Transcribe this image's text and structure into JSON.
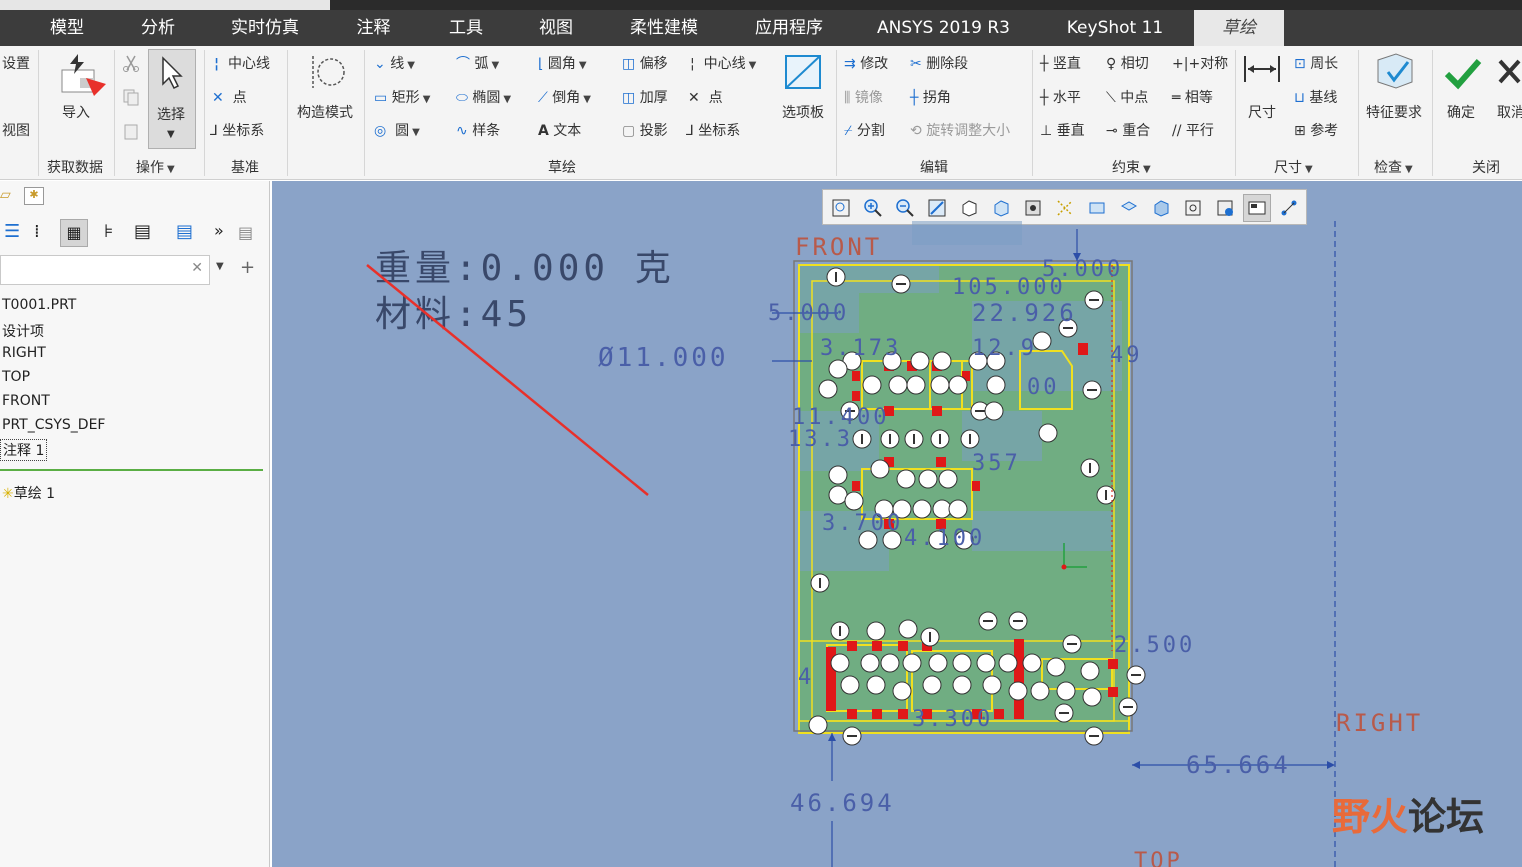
{
  "tabs": [
    {
      "label": "模型"
    },
    {
      "label": "分析"
    },
    {
      "label": "实时仿真"
    },
    {
      "label": "注释"
    },
    {
      "label": "工具"
    },
    {
      "label": "视图"
    },
    {
      "label": "柔性建模"
    },
    {
      "label": "应用程序"
    },
    {
      "label": "ANSYS 2019 R3"
    },
    {
      "label": "KeyShot 11"
    },
    {
      "label": "草绘"
    }
  ],
  "active_tab": "草绘",
  "ribbon": {
    "settings": {
      "setup": "设置",
      "view": "视图"
    },
    "get_data": {
      "import": "导入",
      "group": "获取数据"
    },
    "operations": {
      "select": "选择",
      "group": "操作"
    },
    "datum": {
      "centerline": "中心线",
      "point": "点",
      "csys": "坐标系",
      "group": "基准"
    },
    "construction": {
      "mode": "构造模式"
    },
    "sketch": {
      "line": "线",
      "arc": "弧",
      "fillet": "圆角",
      "offset": "偏移",
      "centerline": "中心线",
      "rectangle": "矩形",
      "ellipse": "椭圆",
      "chamfer": "倒角",
      "thicken": "加厚",
      "point": "点",
      "circle": "圆",
      "spline": "样条",
      "text": "文本",
      "project": "投影",
      "csys": "坐标系",
      "palette": "选项板",
      "group": "草绘"
    },
    "edit": {
      "modify": "修改",
      "delete_segment": "删除段",
      "mirror": "镜像",
      "corner": "拐角",
      "divide": "分割",
      "rotate_resize": "旋转调整大小",
      "group": "编辑"
    },
    "constrain": {
      "vertical": "竖直",
      "tangent": "相切",
      "symmetric": "对称",
      "horizontal": "水平",
      "midpoint": "中点",
      "equal": "相等",
      "perpendicular": "垂直",
      "coincident": "重合",
      "parallel": "平行",
      "group": "约束"
    },
    "dimension": {
      "dimension": "尺寸",
      "perimeter": "周长",
      "baseline": "基线",
      "reference": "参考",
      "group": "尺寸"
    },
    "inspect": {
      "feature_req": "特征要求",
      "group": "检查"
    },
    "close": {
      "ok": "确定",
      "cancel": "取消",
      "group": "关闭"
    }
  },
  "model_tree": {
    "items": [
      "T0001.PRT",
      "设计项",
      "RIGHT",
      "TOP",
      "FRONT",
      "PRT_CSYS_DEF",
      "注释 1",
      "草绘 1"
    ],
    "selected": "注释 1"
  },
  "canvas": {
    "mass_label": "重量:0.000 克",
    "material_label": "材料:45",
    "datum_front": "FRONT",
    "datum_right": "RIGHT",
    "datum_top": "TOP",
    "dims": {
      "d1": "105.000",
      "d2": "5.000",
      "d3": "22.926",
      "d4": "5.000",
      "d5": "Ø11.000",
      "d6": "3.173",
      "d7": "12.9",
      "d8": "49",
      "d9": "00",
      "d10": "11.400",
      "d11": "13.3",
      "d12": "357",
      "d13": "3.700",
      "d14": "4.100",
      "d15": "2.500",
      "d16": "3.300",
      "d17": "65.664",
      "d18": "46.694",
      "d19": "4"
    }
  },
  "watermark": {
    "text1": "野火",
    "text2": "论坛"
  },
  "colors": {
    "canvas_bg": "#8aa3c8",
    "pcb_green": "#6fae7e",
    "sketch_yellow": "#f0e020",
    "pad_red": "#e01818",
    "dim_blue": "#4a5fa8",
    "accent_green": "#22a040"
  }
}
